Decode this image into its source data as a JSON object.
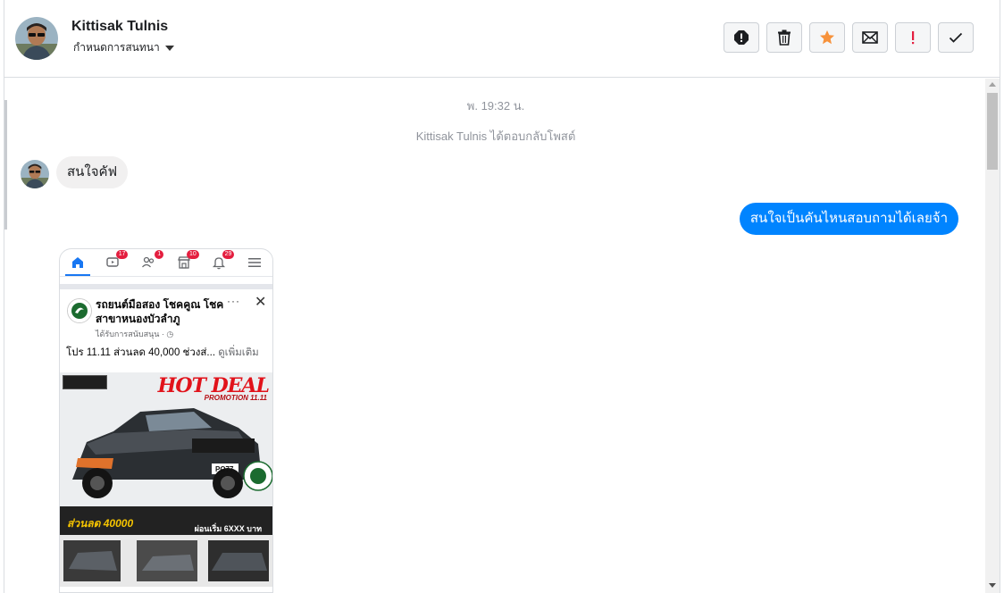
{
  "header": {
    "name": "Kittisak Tulnis",
    "subtitle": "กำหนดการสนทนา",
    "actions": [
      "spam-icon",
      "trash-icon",
      "star-icon",
      "envelope-icon",
      "exclamation-icon",
      "check-icon"
    ],
    "star_color": "#f7923b"
  },
  "conversation": {
    "timestamp": "พ. 19:32 น.",
    "system_message": "Kittisak Tulnis ได้ตอบกลับโพสต์",
    "incoming_message": "สนใจคัฟ",
    "outgoing_message": "สนใจเป็นคันไหนสอบถามได้เลยจ้า",
    "outgoing_color": "#0084ff"
  },
  "attachment": {
    "nav_badges": [
      "17",
      "1",
      "10",
      "29"
    ],
    "page_name": "รถยนต์มือสอง โชคคูณ โชค สาขาหนองบัวลำภู",
    "sponsored": "ได้รับการสนับสนุน · ",
    "post_text": "โปร 11.11 ส่วนลด 40,000 ช่วงส่... ",
    "see_more": "ดูเพิ่มเติม",
    "ad_title": "HOT DEAL",
    "ad_subtitle": "PROMOTION 11.11",
    "ad_plate": "PO77",
    "ad_discount": "ส่วนลด 40000",
    "ad_start_price": "ผ่อนเริ่ม 6XXX บาท"
  }
}
